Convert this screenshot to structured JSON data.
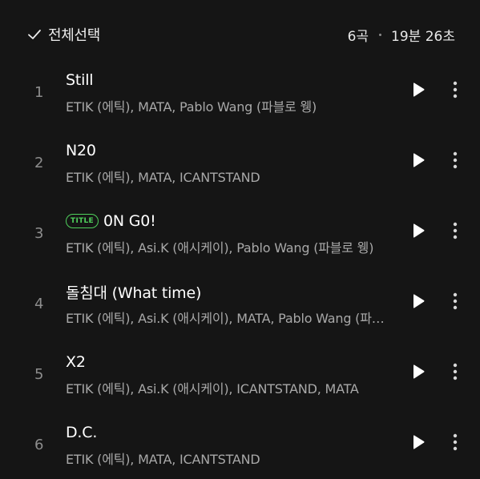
{
  "header": {
    "select_all_label": "전체선택",
    "track_count": "6곡",
    "total_duration": "19분 26초"
  },
  "colors": {
    "background": "#151515",
    "title_badge": "#4fcf5b",
    "primary_text": "#ffffff",
    "secondary_text": "#a8a8a8"
  },
  "tracks": [
    {
      "number": "1",
      "title": "Still",
      "badge": "",
      "artists": "ETIK (에틱), MATA, Pablo Wang (파블로 웽)"
    },
    {
      "number": "2",
      "title": "N20",
      "badge": "",
      "artists": "ETIK (에틱), MATA, ICANTSTAND"
    },
    {
      "number": "3",
      "title": "0N G0!",
      "badge": "TITLE",
      "artists": "ETIK (에틱), Asi.K (애시케이), Pablo Wang (파블로 웽)"
    },
    {
      "number": "4",
      "title": "돌침대 (What time)",
      "badge": "",
      "artists": "ETIK (에틱), Asi.K (애시케이), MATA, Pablo Wang (파블로 웽)"
    },
    {
      "number": "5",
      "title": "X2",
      "badge": "",
      "artists": "ETIK (에틱), Asi.K (애시케이), ICANTSTAND, MATA"
    },
    {
      "number": "6",
      "title": "D.C.",
      "badge": "",
      "artists": "ETIK (에틱), MATA, ICANTSTAND"
    }
  ],
  "icons": {
    "select_all": "check-icon",
    "play": "play-icon",
    "more": "more-vertical-icon"
  }
}
